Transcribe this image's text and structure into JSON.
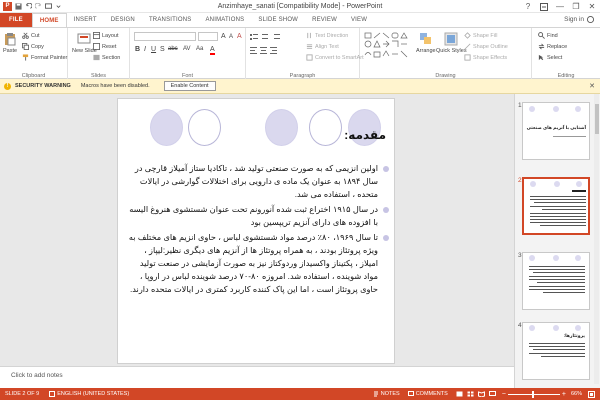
{
  "window": {
    "title": "Anzimhaye_sanati [Compatibility Mode] - PowerPoint",
    "help": "?",
    "minimize": "—",
    "restore": "❐",
    "close": "✕"
  },
  "tabs": [
    "FILE",
    "HOME",
    "INSERT",
    "DESIGN",
    "TRANSITIONS",
    "ANIMATIONS",
    "SLIDE SHOW",
    "REVIEW",
    "VIEW"
  ],
  "active_tab": "HOME",
  "signin": "Sign in",
  "ribbon": {
    "clipboard": {
      "paste": "Paste",
      "cut": "Cut",
      "copy": "Copy",
      "format_painter": "Format Painter",
      "label": "Clipboard"
    },
    "slides": {
      "new_slide": "New Slide",
      "layout": "Layout",
      "reset": "Reset",
      "section": "Section",
      "label": "Slides"
    },
    "font": {
      "label": "Font"
    },
    "paragraph": {
      "text_direction": "Text Direction",
      "align_text": "Align Text",
      "convert_smartart": "Convert to SmartArt",
      "label": "Paragraph"
    },
    "drawing": {
      "arrange": "Arrange",
      "quick_styles": "Quick Styles",
      "shape_fill": "Shape Fill",
      "shape_outline": "Shape Outline",
      "shape_effects": "Shape Effects",
      "label": "Drawing"
    },
    "editing": {
      "find": "Find",
      "replace": "Replace",
      "select": "Select",
      "label": "Editing"
    }
  },
  "security": {
    "title": "SECURITY WARNING",
    "message": "Macros have been disabled.",
    "button": "Enable Content",
    "close": "✕"
  },
  "slide": {
    "title": "مقدمه:",
    "bullets": [
      "اولین انزیمی که به صورت صنعتی تولید شد ، تاکادیا ستاز آمیلاز قارچی در سال ۱۸۹۴ به عنوان یک ماده ی دارویی برای اختلالات گوارشی در ایالات متحده ، استفاده می شد.",
      "در سال ۱۹۱۵ اختراع ثبت شده آنورونم تحت عنوان شستشوی هنروغ الیسه با افزوده های دارای آنزیم تریپسین بود",
      "تا سال ۱۹۶۹، ۸۰٪ درصد مواد شستشوی لباس ، حاوی انزیم های مختلف به ویژه پروتئاز بودند ، به همراه پروتئاز ها از آنزیم های دیگری نظیر:لیپاز ، امیلاز ، پکتیناز واکسیداز وردوکتاز نیز به صورت آزمایشی در صنعت تولید مواد شوینده ، استفاده شد. امروزه ۸۰-۷۰ درصد شوینده لباس در اروپا ، حاوی پروتئاز است ، اما این پاک کننده کاربرد کمتری در ایالات متحده دارند."
    ]
  },
  "notes_placeholder": "Click to add notes",
  "thumbnails": [
    {
      "num": "1",
      "title": "آشنایی با آنزیم های صنعتی"
    },
    {
      "num": "2"
    },
    {
      "num": "3"
    },
    {
      "num": "4",
      "title": "پروتئازها:"
    }
  ],
  "status": {
    "slide": "SLIDE 2 OF 9",
    "language": "ENGLISH (UNITED STATES)",
    "notes": "NOTES",
    "comments": "COMMENTS",
    "zoom": "66%"
  },
  "colors": {
    "accent": "#d24726",
    "warning_bg": "#fff4ce",
    "circle": "#dad8ee"
  }
}
